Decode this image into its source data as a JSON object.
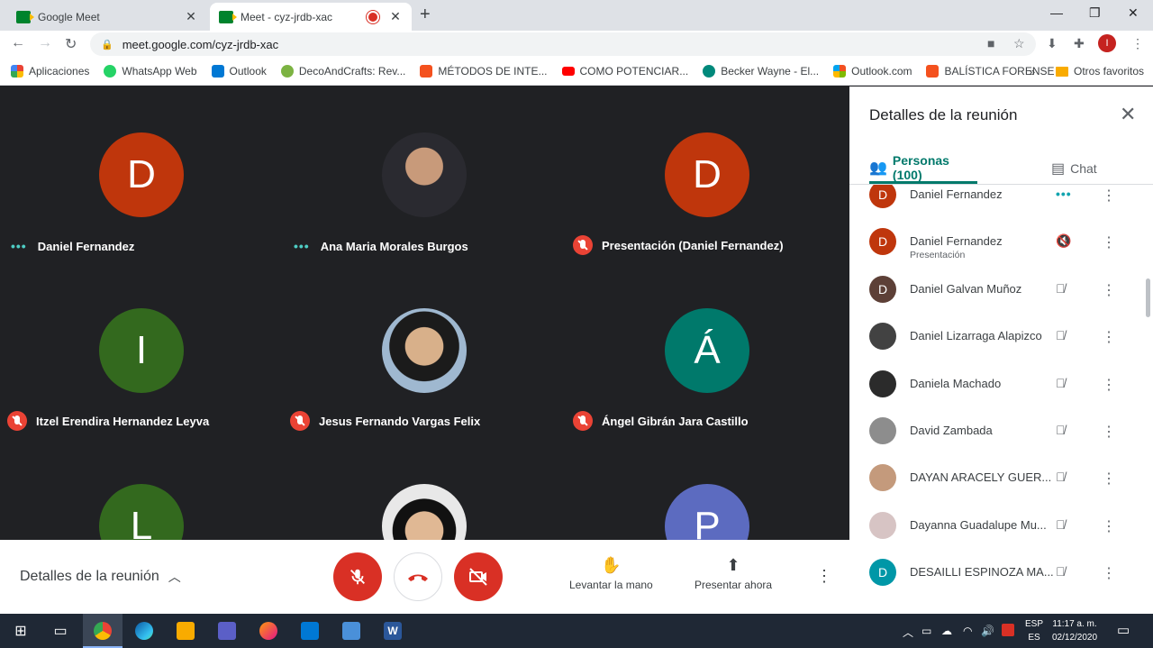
{
  "browser": {
    "tabs": [
      {
        "title": "Google Meet"
      },
      {
        "title": "Meet - cyz-jrdb-xac"
      }
    ],
    "url": "meet.google.com/cyz-jrdb-xac",
    "bookmarks": [
      {
        "label": "Aplicaciones",
        "color": "#4285f4"
      },
      {
        "label": "WhatsApp Web",
        "color": "#25d366"
      },
      {
        "label": "Outlook",
        "color": "#0078d4"
      },
      {
        "label": "DecoAndCrafts: Rev...",
        "color": "#7cb342"
      },
      {
        "label": "MÉTODOS DE INTE...",
        "color": "#f4511e"
      },
      {
        "label": "COMO POTENCIAR...",
        "color": "#ff0000"
      },
      {
        "label": "Becker Wayne - El...",
        "color": "#00897b"
      },
      {
        "label": "Outlook.com",
        "color": "#f25022"
      },
      {
        "label": "BALÍSTICA FORENSE",
        "color": "#f4511e"
      }
    ],
    "bookmarks_other": "Otros favoritos",
    "profile_initial": "I"
  },
  "stage": {
    "tiles": [
      {
        "initial": "D",
        "color": "#bf360c",
        "name": "Daniel Fernandez",
        "status": "speaking"
      },
      {
        "initial": "",
        "color": "photo",
        "name": "Ana Maria Morales Burgos",
        "status": "speaking"
      },
      {
        "initial": "D",
        "color": "#bf360c",
        "name": "Presentación (Daniel Fernandez)",
        "status": "muted"
      },
      {
        "initial": "I",
        "color": "#33691e",
        "name": "Itzel Erendira Hernandez Leyva",
        "status": "muted"
      },
      {
        "initial": "",
        "color": "photo",
        "name": "Jesus Fernando Vargas Felix",
        "status": "muted"
      },
      {
        "initial": "Á",
        "color": "#00796b",
        "name": "Ángel Gibrán Jara Castillo",
        "status": "muted"
      },
      {
        "initial": "L",
        "color": "#33691e",
        "name": "",
        "status": ""
      },
      {
        "initial": "",
        "color": "photo",
        "name": "",
        "status": ""
      },
      {
        "initial": "P",
        "color": "#5c6bc0",
        "name": "",
        "status": ""
      }
    ]
  },
  "controls": {
    "details_label": "Detalles de la reunión",
    "raise_hand": "Levantar la mano",
    "present_now": "Presentar ahora"
  },
  "panel": {
    "title": "Detalles de la reunión",
    "tab_people": "Personas (100)",
    "tab_chat": "Chat",
    "people": [
      {
        "initial": "D",
        "color": "#bf360c",
        "name": "Daniel Fernandez",
        "sub": "",
        "status": "live"
      },
      {
        "initial": "D",
        "color": "#bf360c",
        "name": "Daniel Fernandez",
        "sub": "Presentación",
        "status": "audio-off"
      },
      {
        "initial": "D",
        "color": "#5d4037",
        "name": "Daniel Galvan Muñoz",
        "sub": "",
        "status": "muted"
      },
      {
        "initial": "",
        "color": "#424242",
        "name": "Daniel Lizarraga Alapizco",
        "sub": "",
        "status": "muted"
      },
      {
        "initial": "",
        "color": "#2b2b2b",
        "name": "Daniela Machado",
        "sub": "",
        "status": "muted"
      },
      {
        "initial": "",
        "color": "#8d8d8d",
        "name": "David Zambada",
        "sub": "",
        "status": "muted"
      },
      {
        "initial": "",
        "color": "#c49a7c",
        "name": "DAYAN ARACELY GUER...",
        "sub": "",
        "status": "muted"
      },
      {
        "initial": "",
        "color": "#d7c4c4",
        "name": "Dayanna Guadalupe Mu...",
        "sub": "",
        "status": "muted"
      },
      {
        "initial": "D",
        "color": "#0097a7",
        "name": "DESAILLI ESPINOZA MA...",
        "sub": "",
        "status": "muted"
      }
    ]
  },
  "taskbar": {
    "lang_top": "ESP",
    "lang_bottom": "ES",
    "time": "11:17 a. m.",
    "date": "02/12/2020"
  }
}
